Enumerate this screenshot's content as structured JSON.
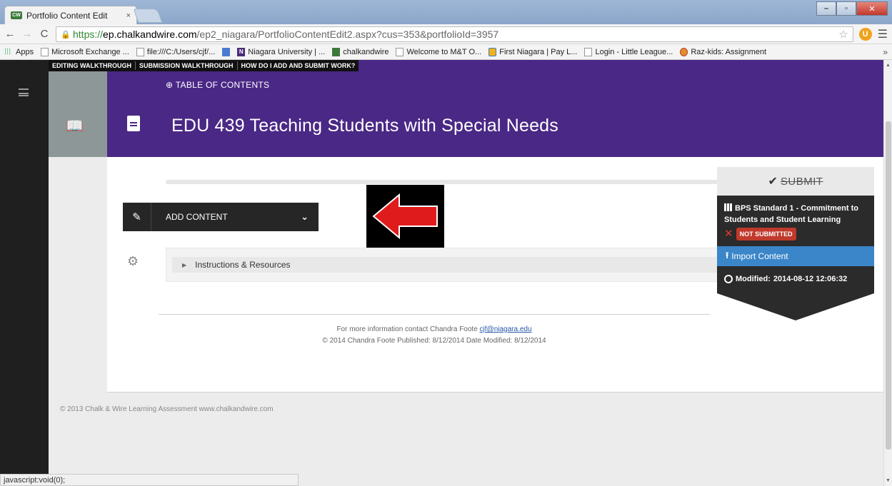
{
  "browser": {
    "tab_title": "Portfolio Content Edit",
    "tab_favicon": "CW",
    "tab_close": "×",
    "url_scheme": "https",
    "url_host": "ep.chalkandwire.com",
    "url_path": "/ep2_niagara/PortfolioContentEdit2.aspx?cus=353&portfolioId=3957",
    "bookmarks": [
      "Apps",
      "Microsoft Exchange ...",
      "file:///C:/Users/cjf/...",
      "",
      "Niagara University | ...",
      "chalkandwire",
      "Welcome to M&T O...",
      "First Niagara | Pay L...",
      "Login - Little League...",
      "Raz-kids: Assignment"
    ],
    "bookmarks_more": "»",
    "status_text": "javascript:void(0);"
  },
  "help_links": [
    "EDITING WALKTHROUGH",
    "SUBMISSION WALKTHROUGH",
    "HOW DO I ADD AND SUBMIT WORK?"
  ],
  "header": {
    "toc_label": "TABLE OF CONTENTS",
    "title": "EDU 439 Teaching Students with Special Needs",
    "color": "#4a2886"
  },
  "content": {
    "add_content_label": "ADD CONTENT",
    "instructions_label": "Instructions & Resources",
    "contact_prefix": "For more information contact Chandra Foote ",
    "contact_email": "cjf@niagara.edu",
    "published_line": "© 2014 Chandra Foote Published: 8/12/2014 Date Modified: 8/12/2014"
  },
  "sidepanel": {
    "submit_label": "SUBMIT",
    "standard_title": "BPS Standard 1 - Commitment to Students and Student Learning",
    "status_badge": "NOT SUBMITTED",
    "import_label": "Import Content",
    "modified_label": "Modified:",
    "modified_value": "2014-08-12 12:06:32",
    "accent_color": "#3a86c9",
    "alert_color": "#c0392b"
  },
  "footer": {
    "copyright": "© 2013 Chalk & Wire Learning Assessment   www.chalkandwire.com"
  }
}
